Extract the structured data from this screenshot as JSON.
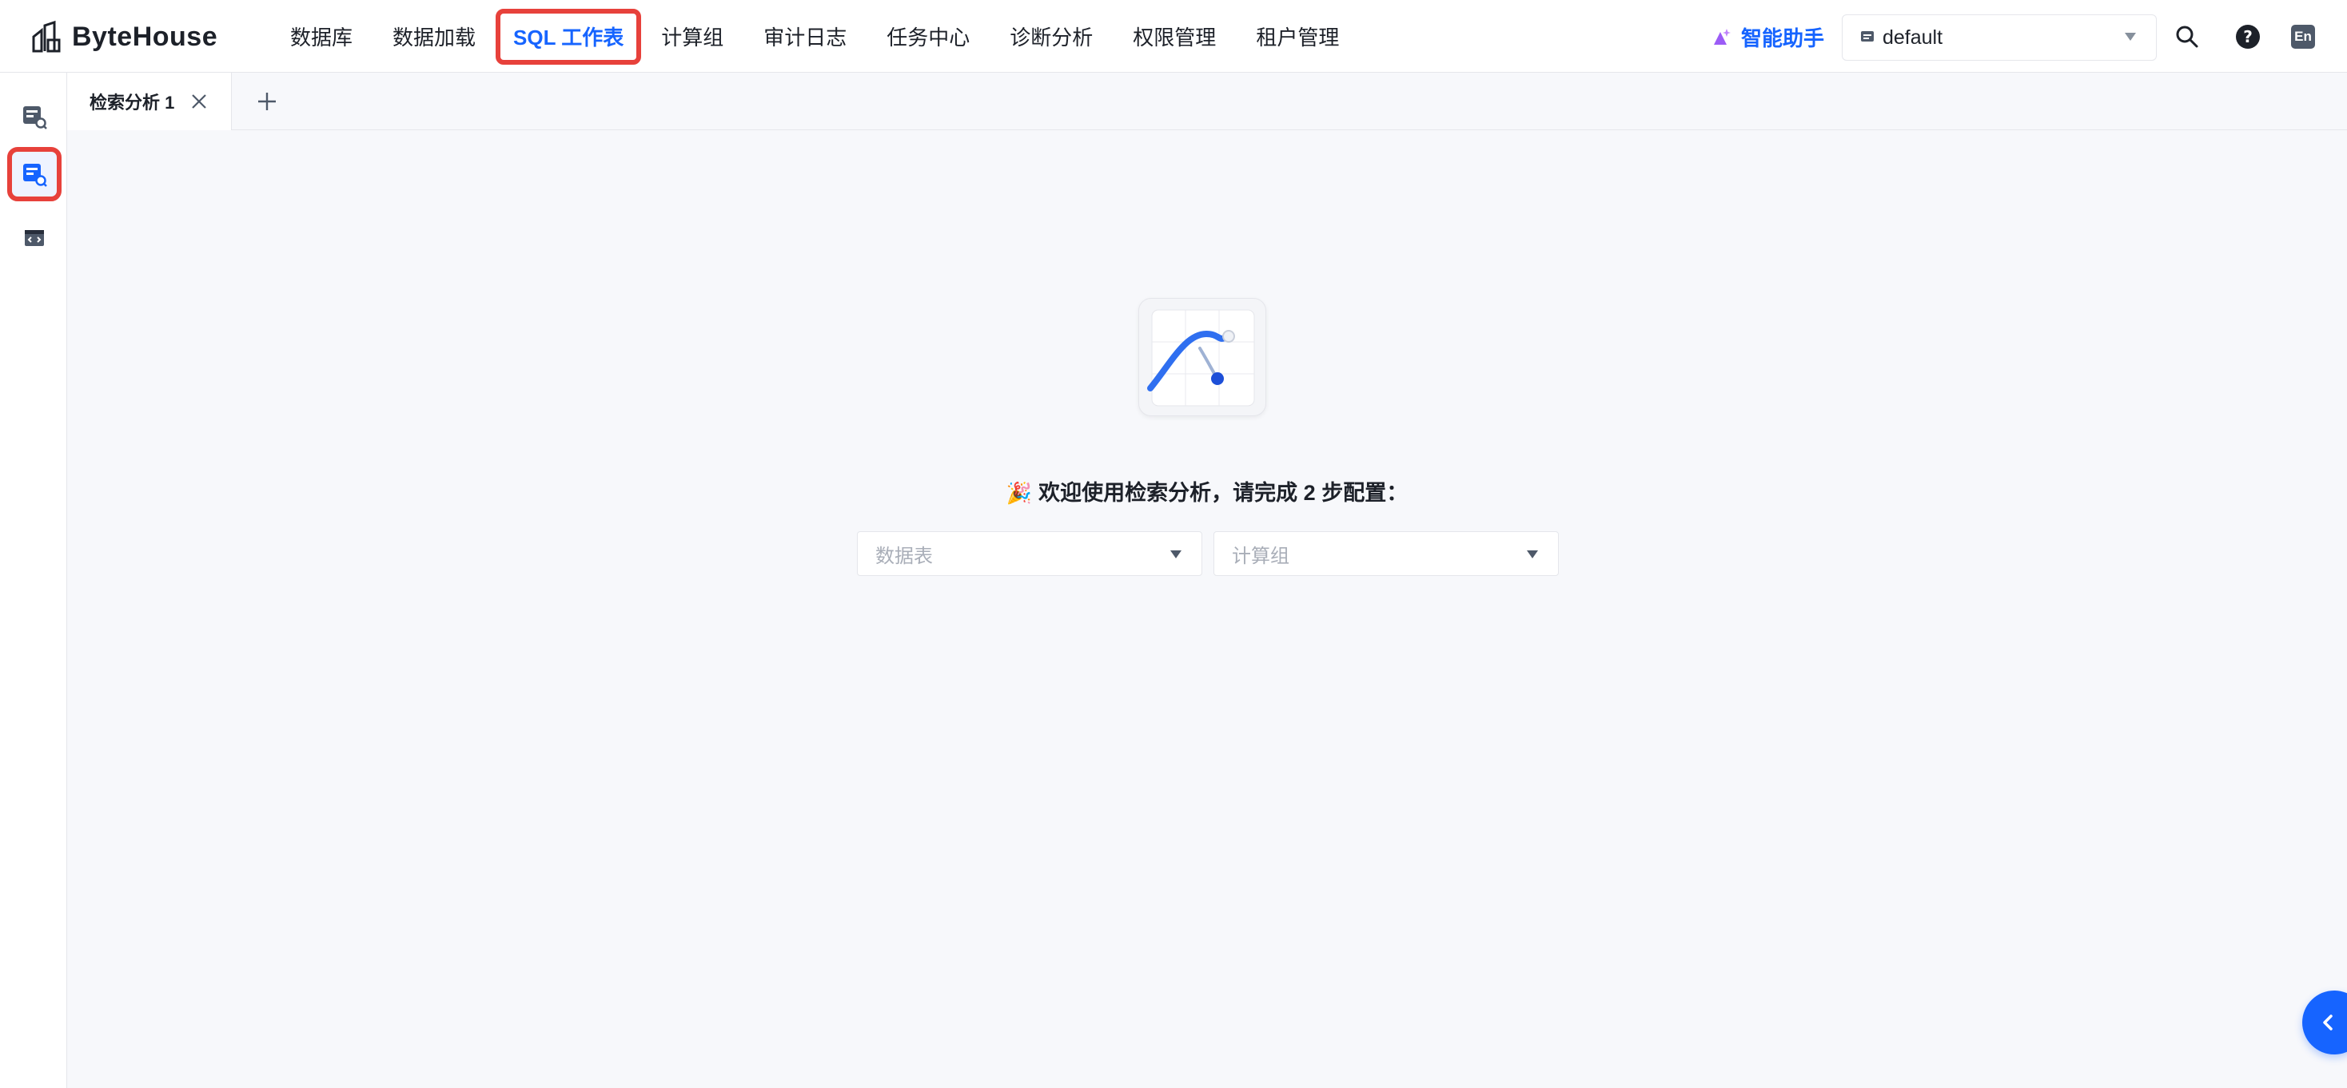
{
  "app": {
    "brand": "ByteHouse"
  },
  "nav": {
    "items": [
      {
        "label": "数据库"
      },
      {
        "label": "数据加载"
      },
      {
        "label": "SQL 工作表",
        "active": true
      },
      {
        "label": "计算组"
      },
      {
        "label": "审计日志"
      },
      {
        "label": "任务中心"
      },
      {
        "label": "诊断分析"
      },
      {
        "label": "权限管理"
      },
      {
        "label": "租户管理"
      }
    ]
  },
  "header": {
    "assistant_label": "智能助手",
    "workspace_value": "default",
    "language_badge": "En"
  },
  "tabs": [
    {
      "label": "检索分析 1"
    }
  ],
  "main": {
    "welcome_emoji": "🎉",
    "welcome_text": "欢迎使用检索分析，请完成 2 步配置：",
    "table_select_placeholder": "数据表",
    "compute_select_placeholder": "计算组"
  },
  "colors": {
    "accent": "#1664ff",
    "highlight_outline": "#e7413b",
    "assistant_icon": "#9b5cf6"
  },
  "icons": {
    "rail": [
      "sql-query-icon",
      "search-analysis-icon",
      "code-panel-icon"
    ],
    "header": [
      "search-icon",
      "help-icon",
      "language-icon"
    ]
  }
}
